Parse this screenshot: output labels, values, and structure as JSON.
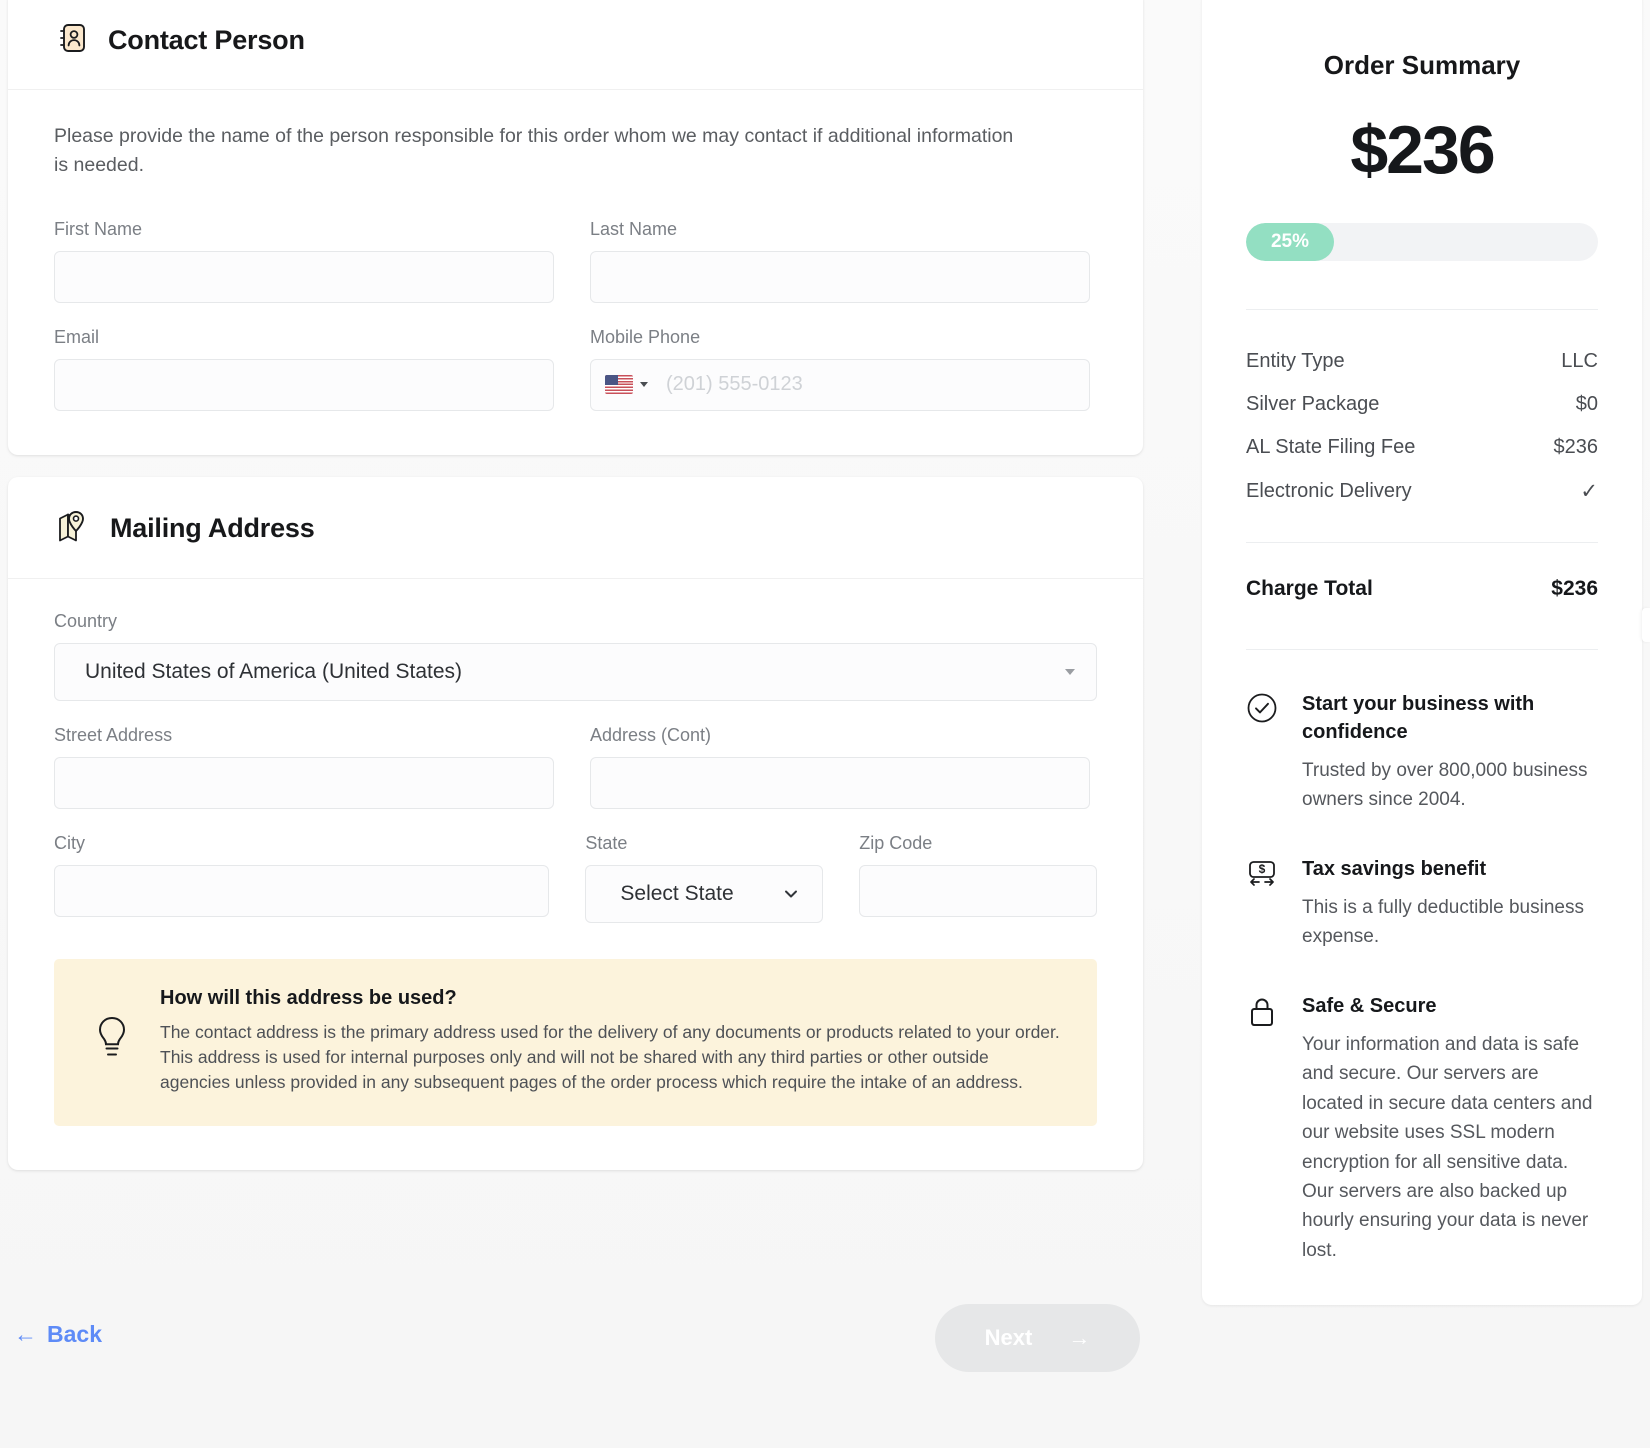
{
  "contact_section": {
    "title": "Contact Person",
    "icon": "contact-card-icon",
    "intro": "Please provide the name of the person responsible for this order whom we may contact if additional information is needed.",
    "fields": {
      "first_name": {
        "label": "First Name",
        "value": "",
        "placeholder": ""
      },
      "last_name": {
        "label": "Last Name",
        "value": "",
        "placeholder": ""
      },
      "email": {
        "label": "Email",
        "value": "",
        "placeholder": ""
      },
      "mobile_phone": {
        "label": "Mobile Phone",
        "value": "",
        "placeholder": "(201) 555-0123",
        "country_flag": "us-flag-icon"
      }
    }
  },
  "mailing_section": {
    "title": "Mailing Address",
    "icon": "map-pin-icon",
    "fields": {
      "country": {
        "label": "Country",
        "value": "United States of America (United States)"
      },
      "street_address": {
        "label": "Street Address",
        "value": "",
        "placeholder": ""
      },
      "address_cont": {
        "label": "Address (Cont)",
        "value": "",
        "placeholder": ""
      },
      "city": {
        "label": "City",
        "value": "",
        "placeholder": ""
      },
      "state": {
        "label": "State",
        "value": "Select State"
      },
      "zip_code": {
        "label": "Zip Code",
        "value": "",
        "placeholder": ""
      }
    },
    "callout": {
      "icon": "lightbulb-icon",
      "heading": "How will this address be used?",
      "body": "The contact address is the primary address used for the delivery of any documents or products related to your order. This address is used for internal purposes only and will not be shared with any third parties or other outside agencies unless provided in any subsequent pages of the order process which require the intake of an address."
    }
  },
  "order_summary": {
    "title": "Order Summary",
    "price": "$236",
    "progress": {
      "percent_label": "25%",
      "percent_value": 25,
      "fill_color": "#93dfc2",
      "track_color": "#f2f3f5"
    },
    "line_items": [
      {
        "label": "Entity Type",
        "value": "LLC"
      },
      {
        "label": "Silver Package",
        "value": "$0"
      },
      {
        "label": "AL State Filing Fee",
        "value": "$236"
      },
      {
        "label": "Electronic Delivery",
        "value": "✓"
      }
    ],
    "total": {
      "label": "Charge Total",
      "value": "$236"
    },
    "benefits": [
      {
        "icon": "check-circle-icon",
        "title": "Start your business with confidence",
        "body": "Trusted by over 800,000 business owners since 2004."
      },
      {
        "icon": "tax-savings-icon",
        "title": "Tax savings benefit",
        "body": "This is a fully deductible business expense."
      },
      {
        "icon": "lock-icon",
        "title": "Safe & Secure",
        "body": "Your information and data is safe and secure. Our servers are located in secure data centers and our website uses SSL modern encryption for all sensitive data. Our servers are also backed up hourly ensuring your data is never lost."
      }
    ]
  },
  "footer": {
    "back_label": "Back",
    "back_arrow": "←",
    "back_color": "#5e8bf7",
    "next_label": "Next",
    "next_arrow": "→",
    "next_disabled_color": "#e6e7e8"
  }
}
